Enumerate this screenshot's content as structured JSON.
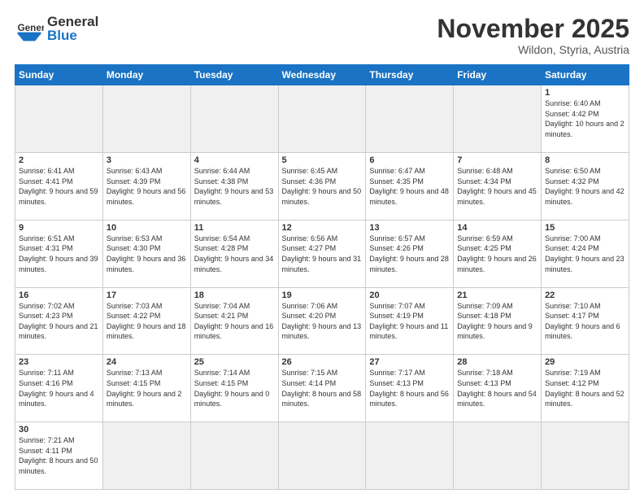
{
  "header": {
    "logo_general": "General",
    "logo_blue": "Blue",
    "month_title": "November 2025",
    "location": "Wildon, Styria, Austria"
  },
  "weekdays": [
    "Sunday",
    "Monday",
    "Tuesday",
    "Wednesday",
    "Thursday",
    "Friday",
    "Saturday"
  ],
  "weeks": [
    [
      {
        "day": "",
        "info": ""
      },
      {
        "day": "",
        "info": ""
      },
      {
        "day": "",
        "info": ""
      },
      {
        "day": "",
        "info": ""
      },
      {
        "day": "",
        "info": ""
      },
      {
        "day": "",
        "info": ""
      },
      {
        "day": "1",
        "info": "Sunrise: 6:40 AM\nSunset: 4:42 PM\nDaylight: 10 hours and 2 minutes."
      }
    ],
    [
      {
        "day": "2",
        "info": "Sunrise: 6:41 AM\nSunset: 4:41 PM\nDaylight: 9 hours and 59 minutes."
      },
      {
        "day": "3",
        "info": "Sunrise: 6:43 AM\nSunset: 4:39 PM\nDaylight: 9 hours and 56 minutes."
      },
      {
        "day": "4",
        "info": "Sunrise: 6:44 AM\nSunset: 4:38 PM\nDaylight: 9 hours and 53 minutes."
      },
      {
        "day": "5",
        "info": "Sunrise: 6:45 AM\nSunset: 4:36 PM\nDaylight: 9 hours and 50 minutes."
      },
      {
        "day": "6",
        "info": "Sunrise: 6:47 AM\nSunset: 4:35 PM\nDaylight: 9 hours and 48 minutes."
      },
      {
        "day": "7",
        "info": "Sunrise: 6:48 AM\nSunset: 4:34 PM\nDaylight: 9 hours and 45 minutes."
      },
      {
        "day": "8",
        "info": "Sunrise: 6:50 AM\nSunset: 4:32 PM\nDaylight: 9 hours and 42 minutes."
      }
    ],
    [
      {
        "day": "9",
        "info": "Sunrise: 6:51 AM\nSunset: 4:31 PM\nDaylight: 9 hours and 39 minutes."
      },
      {
        "day": "10",
        "info": "Sunrise: 6:53 AM\nSunset: 4:30 PM\nDaylight: 9 hours and 36 minutes."
      },
      {
        "day": "11",
        "info": "Sunrise: 6:54 AM\nSunset: 4:28 PM\nDaylight: 9 hours and 34 minutes."
      },
      {
        "day": "12",
        "info": "Sunrise: 6:56 AM\nSunset: 4:27 PM\nDaylight: 9 hours and 31 minutes."
      },
      {
        "day": "13",
        "info": "Sunrise: 6:57 AM\nSunset: 4:26 PM\nDaylight: 9 hours and 28 minutes."
      },
      {
        "day": "14",
        "info": "Sunrise: 6:59 AM\nSunset: 4:25 PM\nDaylight: 9 hours and 26 minutes."
      },
      {
        "day": "15",
        "info": "Sunrise: 7:00 AM\nSunset: 4:24 PM\nDaylight: 9 hours and 23 minutes."
      }
    ],
    [
      {
        "day": "16",
        "info": "Sunrise: 7:02 AM\nSunset: 4:23 PM\nDaylight: 9 hours and 21 minutes."
      },
      {
        "day": "17",
        "info": "Sunrise: 7:03 AM\nSunset: 4:22 PM\nDaylight: 9 hours and 18 minutes."
      },
      {
        "day": "18",
        "info": "Sunrise: 7:04 AM\nSunset: 4:21 PM\nDaylight: 9 hours and 16 minutes."
      },
      {
        "day": "19",
        "info": "Sunrise: 7:06 AM\nSunset: 4:20 PM\nDaylight: 9 hours and 13 minutes."
      },
      {
        "day": "20",
        "info": "Sunrise: 7:07 AM\nSunset: 4:19 PM\nDaylight: 9 hours and 11 minutes."
      },
      {
        "day": "21",
        "info": "Sunrise: 7:09 AM\nSunset: 4:18 PM\nDaylight: 9 hours and 9 minutes."
      },
      {
        "day": "22",
        "info": "Sunrise: 7:10 AM\nSunset: 4:17 PM\nDaylight: 9 hours and 6 minutes."
      }
    ],
    [
      {
        "day": "23",
        "info": "Sunrise: 7:11 AM\nSunset: 4:16 PM\nDaylight: 9 hours and 4 minutes."
      },
      {
        "day": "24",
        "info": "Sunrise: 7:13 AM\nSunset: 4:15 PM\nDaylight: 9 hours and 2 minutes."
      },
      {
        "day": "25",
        "info": "Sunrise: 7:14 AM\nSunset: 4:15 PM\nDaylight: 9 hours and 0 minutes."
      },
      {
        "day": "26",
        "info": "Sunrise: 7:15 AM\nSunset: 4:14 PM\nDaylight: 8 hours and 58 minutes."
      },
      {
        "day": "27",
        "info": "Sunrise: 7:17 AM\nSunset: 4:13 PM\nDaylight: 8 hours and 56 minutes."
      },
      {
        "day": "28",
        "info": "Sunrise: 7:18 AM\nSunset: 4:13 PM\nDaylight: 8 hours and 54 minutes."
      },
      {
        "day": "29",
        "info": "Sunrise: 7:19 AM\nSunset: 4:12 PM\nDaylight: 8 hours and 52 minutes."
      }
    ],
    [
      {
        "day": "30",
        "info": "Sunrise: 7:21 AM\nSunset: 4:11 PM\nDaylight: 8 hours and 50 minutes."
      },
      {
        "day": "",
        "info": ""
      },
      {
        "day": "",
        "info": ""
      },
      {
        "day": "",
        "info": ""
      },
      {
        "day": "",
        "info": ""
      },
      {
        "day": "",
        "info": ""
      },
      {
        "day": "",
        "info": ""
      }
    ]
  ]
}
